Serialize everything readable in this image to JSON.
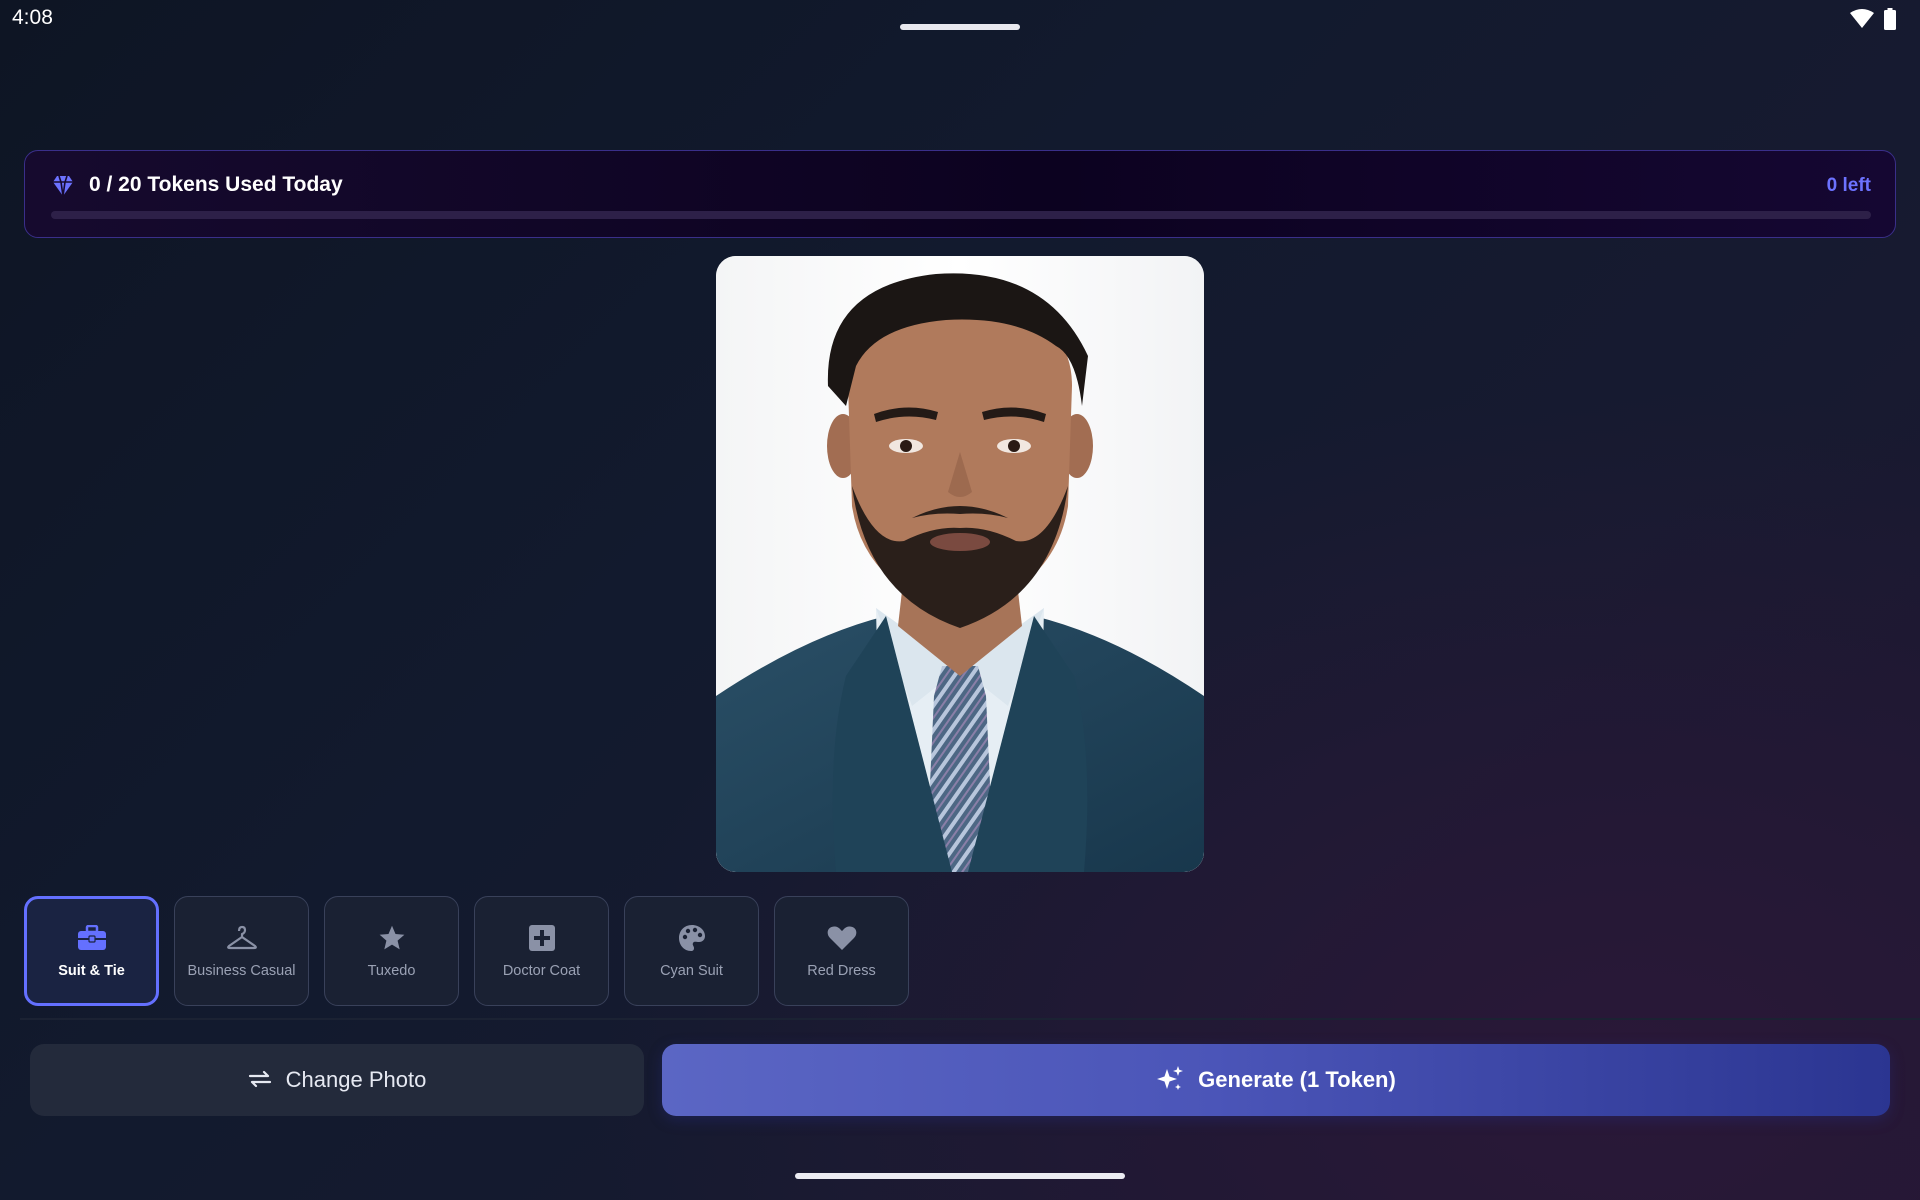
{
  "status_bar": {
    "time": "4:08"
  },
  "token_banner": {
    "title": "0 / 20 Tokens Used Today",
    "remaining": "0 left",
    "used_fraction": 0,
    "accent_color": "#6c72ff"
  },
  "photo": {
    "description_icon": "portrait-photo"
  },
  "styles": [
    {
      "label": "Suit & Tie",
      "icon": "briefcase-icon",
      "selected": true
    },
    {
      "label": "Business Casual",
      "icon": "hanger-icon",
      "selected": false
    },
    {
      "label": "Tuxedo",
      "icon": "star-icon",
      "selected": false
    },
    {
      "label": "Doctor Coat",
      "icon": "medical-cross-icon",
      "selected": false
    },
    {
      "label": "Cyan Suit",
      "icon": "palette-icon",
      "selected": false
    },
    {
      "label": "Red Dress",
      "icon": "heart-icon",
      "selected": false
    }
  ],
  "actions": {
    "change_photo": "Change Photo",
    "generate": "Generate (1 Token)"
  },
  "colors": {
    "accent": "#6470ff",
    "generate_gradient_start": "#5b66c4",
    "generate_gradient_end": "#2b3591"
  }
}
